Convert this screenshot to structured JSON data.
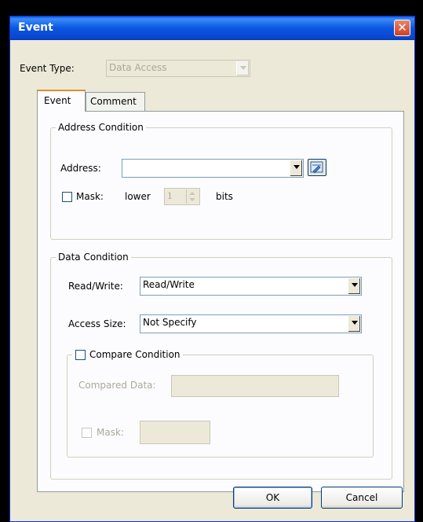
{
  "window": {
    "title": "Event",
    "close_glyph": "✕"
  },
  "event_type": {
    "label": "Event Type:",
    "value": "Data Access"
  },
  "tabs": [
    {
      "label": "Event"
    },
    {
      "label": "Comment"
    }
  ],
  "address_condition": {
    "legend": "Address Condition",
    "address_label": "Address:",
    "address_value": "",
    "mask_label": "Mask:",
    "lower_label": "lower",
    "lower_value": "1",
    "bits_label": "bits"
  },
  "data_condition": {
    "legend": "Data Condition",
    "rw_label": "Read/Write:",
    "rw_value": "Read/Write",
    "size_label": "Access Size:",
    "size_value": "Not Specify",
    "compare": {
      "legend": "Compare Condition",
      "data_label": "Compared Data:",
      "data_value": "",
      "mask_label": "Mask:",
      "mask_value": ""
    }
  },
  "buttons": {
    "ok": "OK",
    "cancel": "Cancel"
  },
  "colors": {
    "title_bar": "#0a55e0",
    "close_button": "#cc4123",
    "dialog_bg": "#ece9d8"
  }
}
